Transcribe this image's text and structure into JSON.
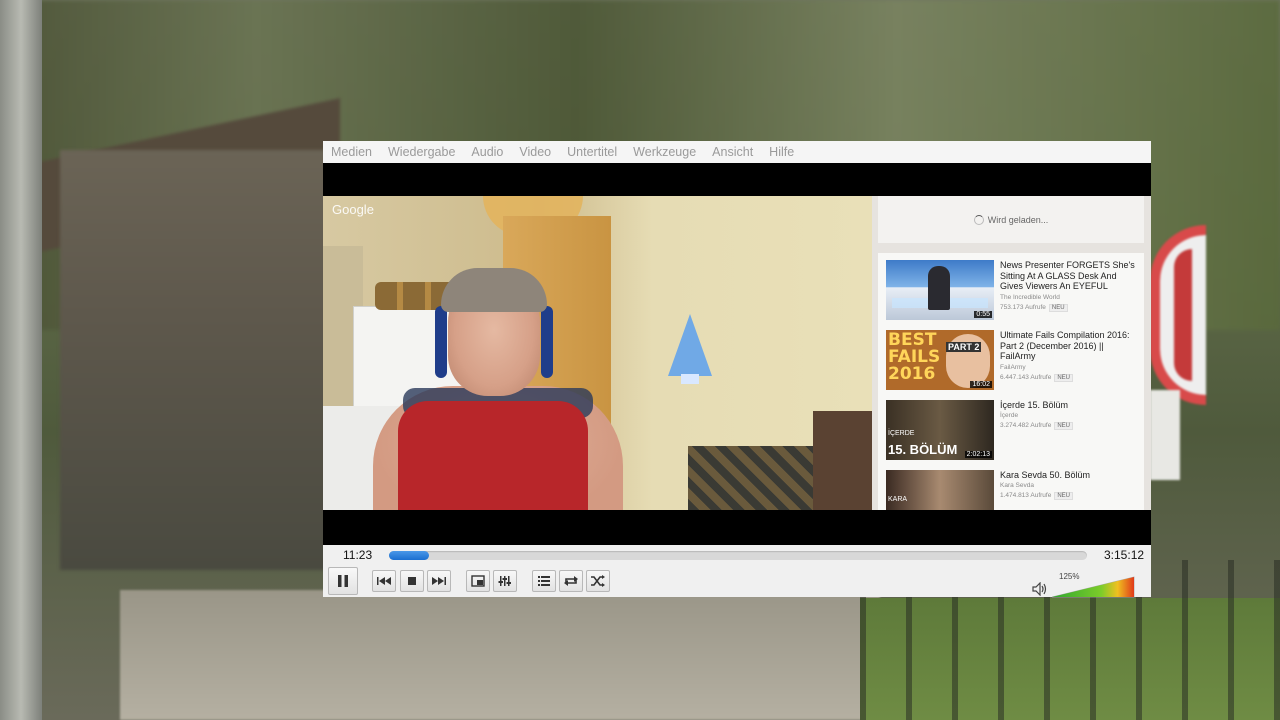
{
  "menu": {
    "items": [
      "Medien",
      "Wiedergabe",
      "Audio",
      "Video",
      "Untertitel",
      "Werkzeuge",
      "Ansicht",
      "Hilfe"
    ]
  },
  "video_overlay": {
    "watermark": "Google",
    "loading_text": "Wird geladen...",
    "recommendations": [
      {
        "title": "News Presenter FORGETS She's Sitting At A GLASS Desk And Gives Viewers An EYEFUL",
        "channel": "The Incredible World",
        "views": "753.173 Aufrufe",
        "badge": "NEU",
        "duration": "0:55",
        "thumb_text": ""
      },
      {
        "title": "Ultimate Fails Compilation 2016: Part 2 (December 2016) || FailArmy",
        "channel": "FailArmy",
        "views": "6.447.143 Aufrufe",
        "badge": "NEU",
        "duration": "16:02",
        "thumb_text": "BEST FAILS 2016",
        "thumb_text_2": "PART 2"
      },
      {
        "title": "İçerde 15. Bölüm",
        "channel": "İçerde",
        "views": "3.274.482 Aufrufe",
        "badge": "NEU",
        "duration": "2:02:13",
        "thumb_text": "İÇERDE",
        "thumb_text_2": "15. BÖLÜM"
      },
      {
        "title": "Kara Sevda 50. Bölüm",
        "channel": "Kara Sevda",
        "views": "1.474.813 Aufrufe",
        "badge": "NEU",
        "duration": "",
        "thumb_text": "KARA"
      }
    ]
  },
  "playback": {
    "elapsed": "11:23",
    "total": "3:15:12",
    "progress_fraction": 0.058,
    "accent_color": "#1b6fd0"
  },
  "volume": {
    "percent_label": "125%",
    "level_fraction": 1.0
  },
  "icons": [
    "pause-icon",
    "previous-icon",
    "stop-icon",
    "next-icon",
    "fullscreen-icon",
    "equalizer-icon",
    "playlist-icon",
    "loop-icon",
    "shuffle-icon",
    "speaker-icon"
  ]
}
